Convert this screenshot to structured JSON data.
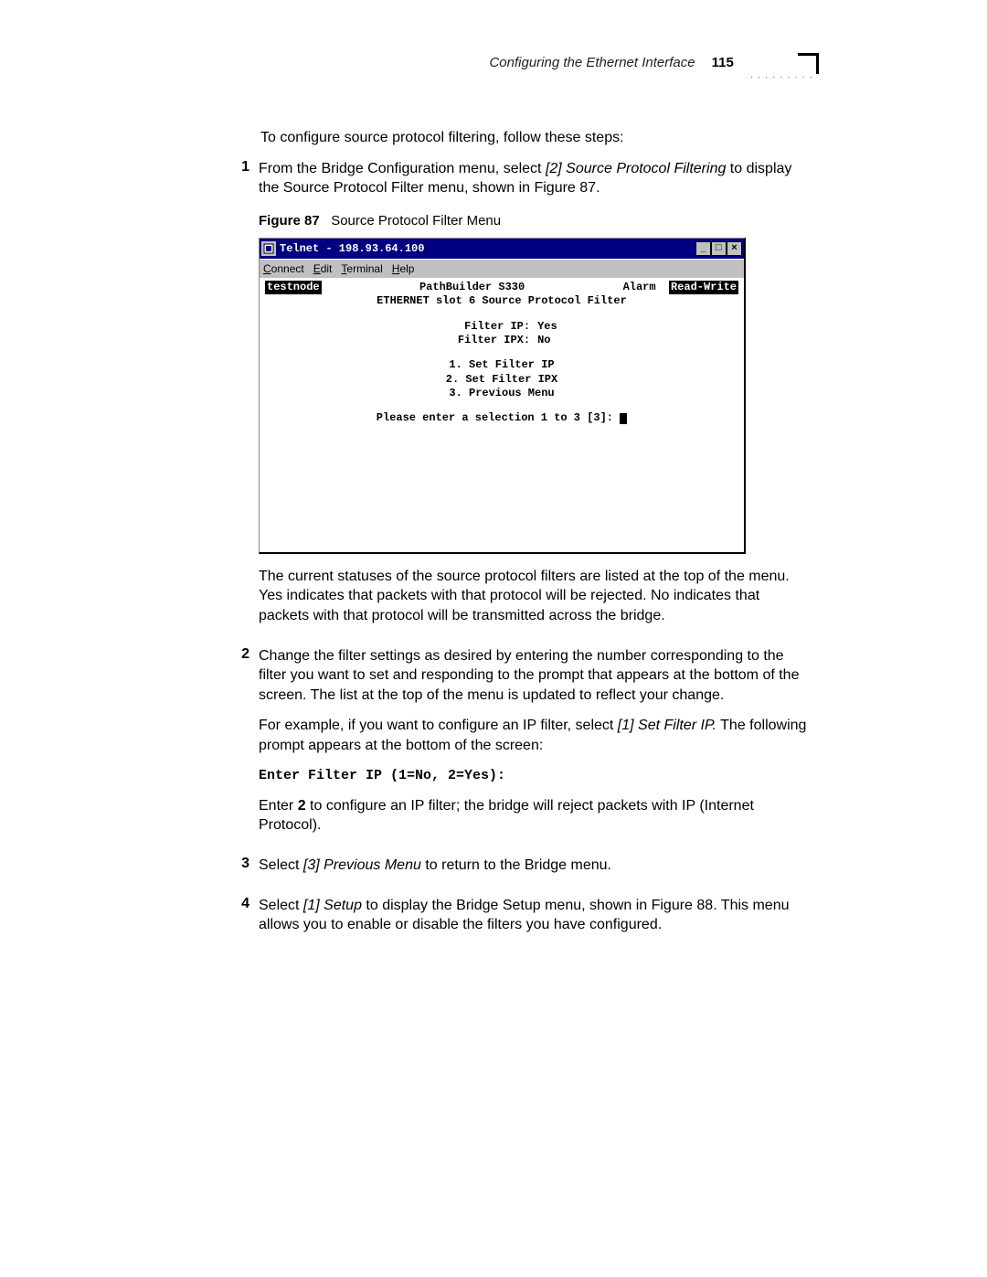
{
  "header": {
    "title": "Configuring the Ethernet Interface",
    "page_number": "115"
  },
  "intro": "To configure source protocol filtering, follow these steps:",
  "steps": {
    "1": {
      "pre": "From the Bridge Configuration menu, select ",
      "italic": "[2] Source Protocol Filtering",
      "post": " to display the Source Protocol Filter menu, shown in Figure 87."
    },
    "after_figure_p1": "The current statuses of the source protocol filters are listed at the top of the menu. Yes indicates that packets with that protocol will be rejected. No indicates that packets with that protocol will be transmitted across the bridge.",
    "2": {
      "p1": "Change the filter settings as desired by entering the number corresponding to the filter you want to set and responding to the prompt that appears at the bottom of the screen. The list at the top of the menu is updated to reflect your change.",
      "p2_pre": "For example, if you want to configure an IP filter, select ",
      "p2_italic": "[1] Set Filter IP.",
      "p2_post": " The following prompt appears at the bottom of the screen:",
      "code": "Enter Filter IP (1=No, 2=Yes):",
      "p3_pre": "Enter ",
      "p3_bold": "2",
      "p3_post": " to configure an IP filter; the bridge will reject packets with IP (Internet Protocol)."
    },
    "3": {
      "pre": "Select ",
      "italic": "[3] Previous Menu",
      "post": " to return to the Bridge menu."
    },
    "4": {
      "pre": "Select ",
      "italic": "[1] Setup",
      "post": " to display the Bridge Setup menu, shown in Figure 88. This menu allows you to enable or disable the filters you have configured."
    }
  },
  "figure": {
    "label": "Figure 87",
    "caption": "Source Protocol Filter Menu"
  },
  "telnet": {
    "titlebar": "Telnet - 198.93.64.100",
    "menubar": {
      "connect": "Connect",
      "edit": "Edit",
      "terminal": "Terminal",
      "help": "Help"
    },
    "window_buttons": {
      "min": "_",
      "max": "□",
      "close": "×"
    },
    "status": {
      "node": "testnode",
      "product": "PathBuilder S330",
      "alarm": "Alarm",
      "mode": "Read-Write"
    },
    "subtitle": "ETHERNET slot 6 Source Protocol Filter",
    "filters": [
      {
        "label": "Filter IP:",
        "value": "Yes"
      },
      {
        "label": "Filter IPX:",
        "value": "No"
      }
    ],
    "menu_items": [
      "1. Set Filter IP",
      "2. Set Filter IPX",
      "3. Previous Menu"
    ],
    "prompt": "Please enter a selection 1 to 3 [3]: "
  }
}
